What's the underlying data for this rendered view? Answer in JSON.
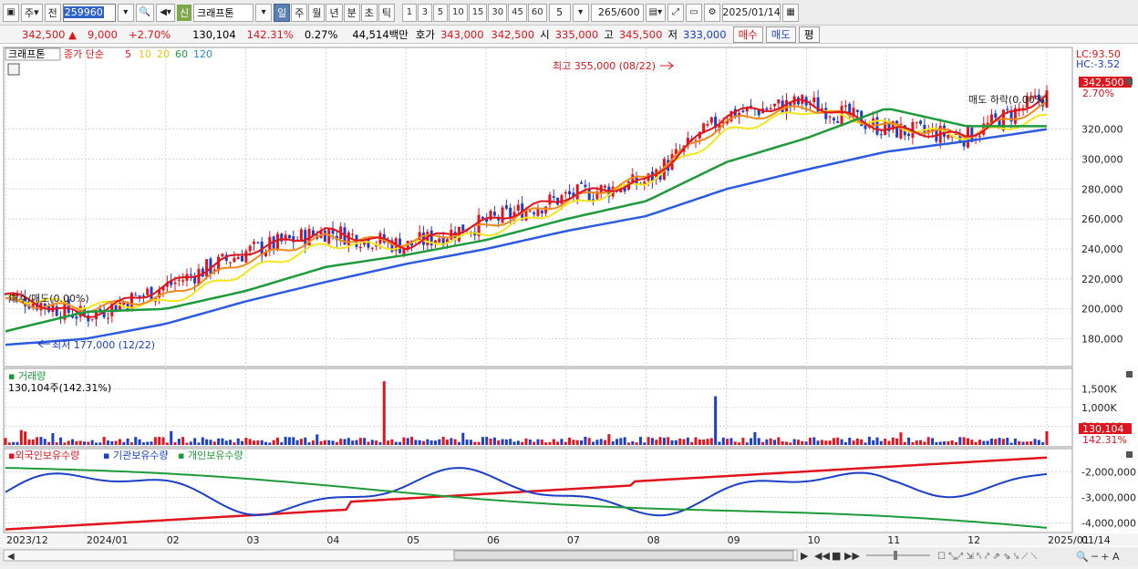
{
  "toolbar": {
    "market_label": "주",
    "prev_label": "전",
    "stock_code": "259960",
    "stock_name": "크래프톤",
    "sin_label": "신",
    "periods": [
      "일",
      "주",
      "월",
      "년",
      "분",
      "초",
      "틱"
    ],
    "active_period": "일",
    "intervals": [
      "1",
      "3",
      "5",
      "10",
      "15",
      "30",
      "45",
      "60"
    ],
    "interval_value": "5",
    "count_value": "265",
    "count_max": "/600",
    "date": "2025/01/14"
  },
  "infobar": {
    "price": "342,500",
    "change": "9,000",
    "change_pct": "+2.70%",
    "volume": "130,104",
    "volume_ratio": "142.31%",
    "turnover": "0.27%",
    "trade_value": "44,514백만",
    "ask_label": "호가",
    "ask1": "343,000",
    "ask2": "342,500",
    "open_label": "시",
    "open": "335,000",
    "high_label": "고",
    "high": "345,500",
    "low_label": "저",
    "low": "333,000",
    "buy_label": "매수",
    "sell_label": "매도",
    "eval_label": "평"
  },
  "price_panel": {
    "stock_tag": "크래프톤",
    "ma_title": "종가 단순",
    "ma_periods": [
      "5",
      "10",
      "20",
      "60",
      "120"
    ],
    "lc": "LC:93.50",
    "hc": "HC:-3.52",
    "last_price": "342,500",
    "last_pct": "2.70%",
    "high_note": "최고 355,000 (08/22)",
    "low_note": "최저 177,000 (12/22)",
    "left_note": "매수/매도(0.00%)",
    "right_note": "매도 하락(0.00%)",
    "y_ticks": [
      "320,000",
      "300,000",
      "280,000",
      "260,000",
      "240,000",
      "220,000",
      "200,000",
      "180,000"
    ]
  },
  "volume_panel": {
    "title": "거래량",
    "value": "130,104주(142.31%)",
    "y_ticks": [
      "1,500K",
      "1,000K",
      "500,000"
    ],
    "last_value": "130,104",
    "last_pct": "142.31%"
  },
  "holdings_panel": {
    "titles": [
      "외국인보유수량",
      "기관보유수량",
      "개인보유수량"
    ],
    "y_ticks": [
      "-2,000,000",
      "-3,000,000",
      "-4,000,000"
    ]
  },
  "x_axis": {
    "labels": [
      "2023/12",
      "2024/01",
      "02",
      "03",
      "04",
      "05",
      "06",
      "07",
      "08",
      "09",
      "10",
      "11",
      "12",
      "2025/01"
    ],
    "right_label": "01/14"
  },
  "colors": {
    "ma5": "#e0141c",
    "ma10": "#f08a1c",
    "ma20": "#f5e51c",
    "ma60": "#1e9a3a",
    "ma120": "#2c5be0",
    "up": "#e0141c",
    "down": "#1b3fc7"
  },
  "chart_data": {
    "type": "line",
    "x": [
      "2023/12",
      "2024/01",
      "02",
      "03",
      "04",
      "05",
      "06",
      "07",
      "08",
      "09",
      "10",
      "11",
      "12",
      "2025/01"
    ],
    "series": [
      {
        "values": [
          210000,
          195000,
          215000,
          238000,
          252000,
          242000,
          258000,
          275000,
          285000,
          330000,
          338000,
          320000,
          315000,
          342500
        ]
      },
      {
        "values": [
          205000,
          200000,
          208000,
          232000,
          248000,
          244000,
          255000,
          272000,
          288000,
          325000,
          335000,
          322000,
          316000,
          336000
        ]
      },
      {
        "values": [
          208000,
          202000,
          204000,
          225000,
          243000,
          242000,
          250000,
          268000,
          285000,
          318000,
          333000,
          323000,
          315000,
          328000
        ]
      },
      {
        "values": [
          185000,
          198000,
          200000,
          212000,
          228000,
          236000,
          246000,
          260000,
          272000,
          298000,
          314000,
          334000,
          322000,
          322000
        ]
      },
      {
        "values": [
          176000,
          180000,
          190000,
          205000,
          218000,
          230000,
          240000,
          252000,
          262000,
          280000,
          293000,
          305000,
          312000,
          320000
        ]
      }
    ],
    "ylim": [
      170000,
      360000
    ]
  }
}
